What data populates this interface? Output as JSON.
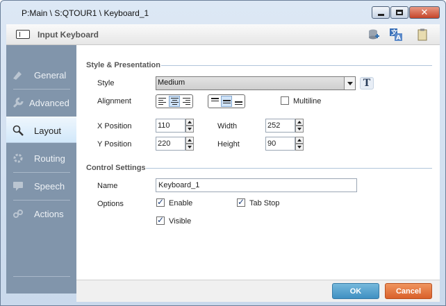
{
  "window": {
    "title": "P:Main \\ S:QTOUR1 \\ Keyboard_1"
  },
  "header": {
    "title": "Input Keyboard"
  },
  "sidebar": {
    "items": [
      {
        "label": "General",
        "icon": "general-icon"
      },
      {
        "label": "Advanced",
        "icon": "wrench-icon"
      },
      {
        "label": "Layout",
        "icon": "layout-icon",
        "active": true
      },
      {
        "label": "Routing",
        "icon": "gear-icon"
      },
      {
        "label": "Speech",
        "icon": "speech-icon"
      },
      {
        "label": "Actions",
        "icon": "actions-icon"
      }
    ]
  },
  "style_section": {
    "title": "Style & Presentation",
    "style_label": "Style",
    "style_value": "Medium",
    "alignment_label": "Alignment",
    "multiline_label": "Multiline",
    "multiline_checked": false,
    "x_label": "X Position",
    "x_value": "110",
    "y_label": "Y Position",
    "y_value": "220",
    "width_label": "Width",
    "width_value": "252",
    "height_label": "Height",
    "height_value": "90"
  },
  "control_section": {
    "title": "Control Settings",
    "name_label": "Name",
    "name_value": "Keyboard_1",
    "options_label": "Options",
    "enable_label": "Enable",
    "tabstop_label": "Tab Stop",
    "visible_label": "Visible"
  },
  "footer": {
    "ok_label": "OK",
    "cancel_label": "Cancel"
  }
}
